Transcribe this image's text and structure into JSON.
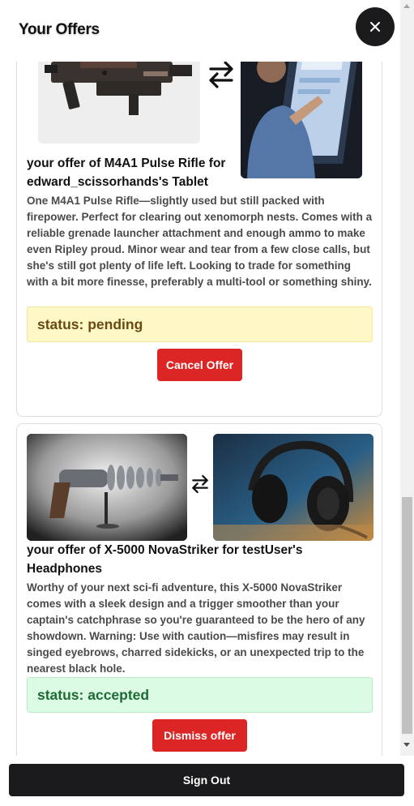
{
  "header": {
    "title": "Your Offers",
    "close_icon": "close-icon"
  },
  "offers": [
    {
      "offered_item_image": "pulse-rifle-photo",
      "requested_item_image": "tablet-user-photo",
      "swap_icon": "swap-arrows-icon",
      "title": "your offer of M4A1 Pulse Rifle for edward_scissorhands's Tablet",
      "description": "One M4A1 Pulse Rifle—slightly used but still packed with firepower. Perfect for clearing out xenomorph nests. Comes with a reliable grenade launcher attachment and enough ammo to make even Ripley proud. Minor wear and tear from a few close calls, but she's still got plenty of life left. Looking to trade for something with a bit more finesse, preferably a multi-tool or something shiny.",
      "status": "status: pending",
      "status_color": "#fef8c6",
      "action_label": "Cancel Offer",
      "action_color": "#dc2626"
    },
    {
      "offered_item_image": "raygun-photo",
      "requested_item_image": "headphones-photo",
      "swap_icon": "swap-arrows-icon",
      "title": "your offer of X-5000 NovaStriker for testUser's Headphones",
      "description": "Worthy of your next sci-fi adventure, this X-5000 NovaStriker comes with a sleek design and a trigger smoother than your captain's catchphrase so you're guaranteed to be the hero of any showdown. Warning: Use with caution—misfires may result in singed eyebrows, charred sidekicks, or an unexpected trip to the nearest black hole.",
      "status": "status: accepted",
      "status_color": "#dcfbe5",
      "action_label": "Dismiss offer",
      "action_color": "#dc2626"
    }
  ],
  "footer": {
    "sign_out_label": "Sign Out"
  }
}
